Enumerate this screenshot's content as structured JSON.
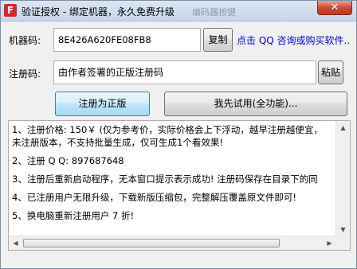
{
  "window": {
    "title": "验证授权 - 绑定机器，永久免费升级",
    "ghost_text": "编码器按键",
    "app_icon_letter": "F",
    "close_label": "✕"
  },
  "form": {
    "machine_label": "机器码:",
    "machine_value": "8E426A620FE08FB8",
    "copy_label": "复制",
    "link_text": "点击 QQ 咨询或购买软件..",
    "reg_label": "注册码:",
    "reg_value": "由作者签署的正版注册码",
    "paste_label": "粘贴"
  },
  "actions": {
    "register_label": "注册为正版",
    "trial_label": "我先试用(全功能)..."
  },
  "notes": [
    "1、注册价格: 150￥ (仅为参考价，实际价格会上下浮动，越早注册越便宜，",
    "未注册版本，不支持批量生成，仅可生成1个看效果!",
    "2、注册 Q Q: 897687648",
    "3、注册后重新启动程序，无本窗口提示表示成功! 注册码保存在目录下的同",
    "4、已注册用户无限升级，下载新版压缩包，完整解压覆盖原文件即可!",
    "5、换电脑重新注册用户 7 折!"
  ],
  "icons": {
    "up": "▲",
    "down": "▼",
    "left": "◀",
    "right": "▶"
  }
}
